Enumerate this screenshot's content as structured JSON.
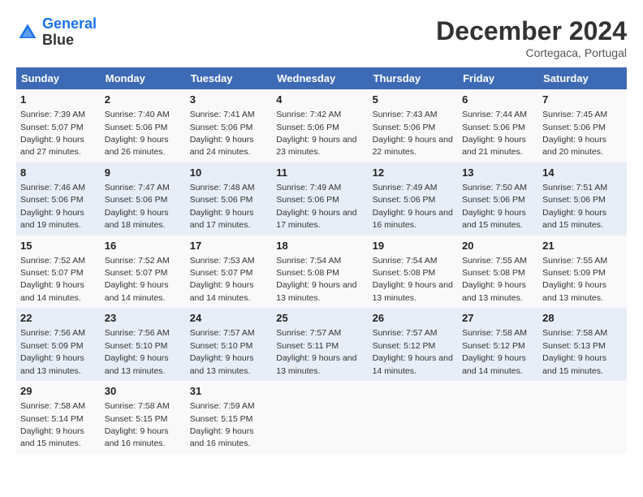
{
  "header": {
    "logo_line1": "General",
    "logo_line2": "Blue",
    "month": "December 2024",
    "location": "Cortegaca, Portugal"
  },
  "weekdays": [
    "Sunday",
    "Monday",
    "Tuesday",
    "Wednesday",
    "Thursday",
    "Friday",
    "Saturday"
  ],
  "weeks": [
    [
      {
        "day": "1",
        "sunrise": "7:39 AM",
        "sunset": "5:07 PM",
        "daylight": "9 hours and 27 minutes."
      },
      {
        "day": "2",
        "sunrise": "7:40 AM",
        "sunset": "5:06 PM",
        "daylight": "9 hours and 26 minutes."
      },
      {
        "day": "3",
        "sunrise": "7:41 AM",
        "sunset": "5:06 PM",
        "daylight": "9 hours and 24 minutes."
      },
      {
        "day": "4",
        "sunrise": "7:42 AM",
        "sunset": "5:06 PM",
        "daylight": "9 hours and 23 minutes."
      },
      {
        "day": "5",
        "sunrise": "7:43 AM",
        "sunset": "5:06 PM",
        "daylight": "9 hours and 22 minutes."
      },
      {
        "day": "6",
        "sunrise": "7:44 AM",
        "sunset": "5:06 PM",
        "daylight": "9 hours and 21 minutes."
      },
      {
        "day": "7",
        "sunrise": "7:45 AM",
        "sunset": "5:06 PM",
        "daylight": "9 hours and 20 minutes."
      }
    ],
    [
      {
        "day": "8",
        "sunrise": "7:46 AM",
        "sunset": "5:06 PM",
        "daylight": "9 hours and 19 minutes."
      },
      {
        "day": "9",
        "sunrise": "7:47 AM",
        "sunset": "5:06 PM",
        "daylight": "9 hours and 18 minutes."
      },
      {
        "day": "10",
        "sunrise": "7:48 AM",
        "sunset": "5:06 PM",
        "daylight": "9 hours and 17 minutes."
      },
      {
        "day": "11",
        "sunrise": "7:49 AM",
        "sunset": "5:06 PM",
        "daylight": "9 hours and 17 minutes."
      },
      {
        "day": "12",
        "sunrise": "7:49 AM",
        "sunset": "5:06 PM",
        "daylight": "9 hours and 16 minutes."
      },
      {
        "day": "13",
        "sunrise": "7:50 AM",
        "sunset": "5:06 PM",
        "daylight": "9 hours and 15 minutes."
      },
      {
        "day": "14",
        "sunrise": "7:51 AM",
        "sunset": "5:06 PM",
        "daylight": "9 hours and 15 minutes."
      }
    ],
    [
      {
        "day": "15",
        "sunrise": "7:52 AM",
        "sunset": "5:07 PM",
        "daylight": "9 hours and 14 minutes."
      },
      {
        "day": "16",
        "sunrise": "7:52 AM",
        "sunset": "5:07 PM",
        "daylight": "9 hours and 14 minutes."
      },
      {
        "day": "17",
        "sunrise": "7:53 AM",
        "sunset": "5:07 PM",
        "daylight": "9 hours and 14 minutes."
      },
      {
        "day": "18",
        "sunrise": "7:54 AM",
        "sunset": "5:08 PM",
        "daylight": "9 hours and 13 minutes."
      },
      {
        "day": "19",
        "sunrise": "7:54 AM",
        "sunset": "5:08 PM",
        "daylight": "9 hours and 13 minutes."
      },
      {
        "day": "20",
        "sunrise": "7:55 AM",
        "sunset": "5:08 PM",
        "daylight": "9 hours and 13 minutes."
      },
      {
        "day": "21",
        "sunrise": "7:55 AM",
        "sunset": "5:09 PM",
        "daylight": "9 hours and 13 minutes."
      }
    ],
    [
      {
        "day": "22",
        "sunrise": "7:56 AM",
        "sunset": "5:09 PM",
        "daylight": "9 hours and 13 minutes."
      },
      {
        "day": "23",
        "sunrise": "7:56 AM",
        "sunset": "5:10 PM",
        "daylight": "9 hours and 13 minutes."
      },
      {
        "day": "24",
        "sunrise": "7:57 AM",
        "sunset": "5:10 PM",
        "daylight": "9 hours and 13 minutes."
      },
      {
        "day": "25",
        "sunrise": "7:57 AM",
        "sunset": "5:11 PM",
        "daylight": "9 hours and 13 minutes."
      },
      {
        "day": "26",
        "sunrise": "7:57 AM",
        "sunset": "5:12 PM",
        "daylight": "9 hours and 14 minutes."
      },
      {
        "day": "27",
        "sunrise": "7:58 AM",
        "sunset": "5:12 PM",
        "daylight": "9 hours and 14 minutes."
      },
      {
        "day": "28",
        "sunrise": "7:58 AM",
        "sunset": "5:13 PM",
        "daylight": "9 hours and 15 minutes."
      }
    ],
    [
      {
        "day": "29",
        "sunrise": "7:58 AM",
        "sunset": "5:14 PM",
        "daylight": "9 hours and 15 minutes."
      },
      {
        "day": "30",
        "sunrise": "7:58 AM",
        "sunset": "5:15 PM",
        "daylight": "9 hours and 16 minutes."
      },
      {
        "day": "31",
        "sunrise": "7:59 AM",
        "sunset": "5:15 PM",
        "daylight": "9 hours and 16 minutes."
      },
      null,
      null,
      null,
      null
    ]
  ]
}
